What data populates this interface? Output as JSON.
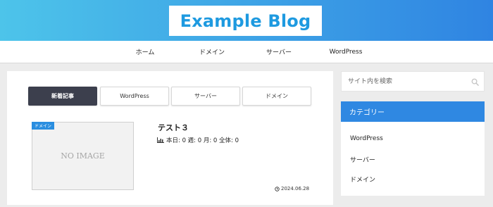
{
  "header": {
    "logo": "Example Blog",
    "accent": "#1e9ae0"
  },
  "nav": {
    "items": [
      {
        "label": "ホーム"
      },
      {
        "label": "ドメイン"
      },
      {
        "label": "サーバー"
      },
      {
        "label": "WordPress"
      }
    ]
  },
  "tabs": [
    {
      "label": "新着記事",
      "active": true
    },
    {
      "label": "WordPress"
    },
    {
      "label": "サーバー"
    },
    {
      "label": "ドメイン"
    }
  ],
  "post": {
    "category": "ドメイン",
    "thumbnail_text": "NO IMAGE",
    "title": "テスト３",
    "stats": "本日: 0  週: 0  月: 0  全体: 0",
    "date": "2024.06.28"
  },
  "search": {
    "placeholder": "サイト内を検索"
  },
  "categories": {
    "heading": "カテゴリー",
    "items": [
      {
        "label": "WordPress"
      },
      {
        "label": "サーバー"
      },
      {
        "label": "ドメイン"
      }
    ]
  },
  "colors": {
    "header_start": "#4dc4ea",
    "header_end": "#2f84e2",
    "active_tab": "#3c3f4d",
    "category_header": "#2f88e2"
  }
}
